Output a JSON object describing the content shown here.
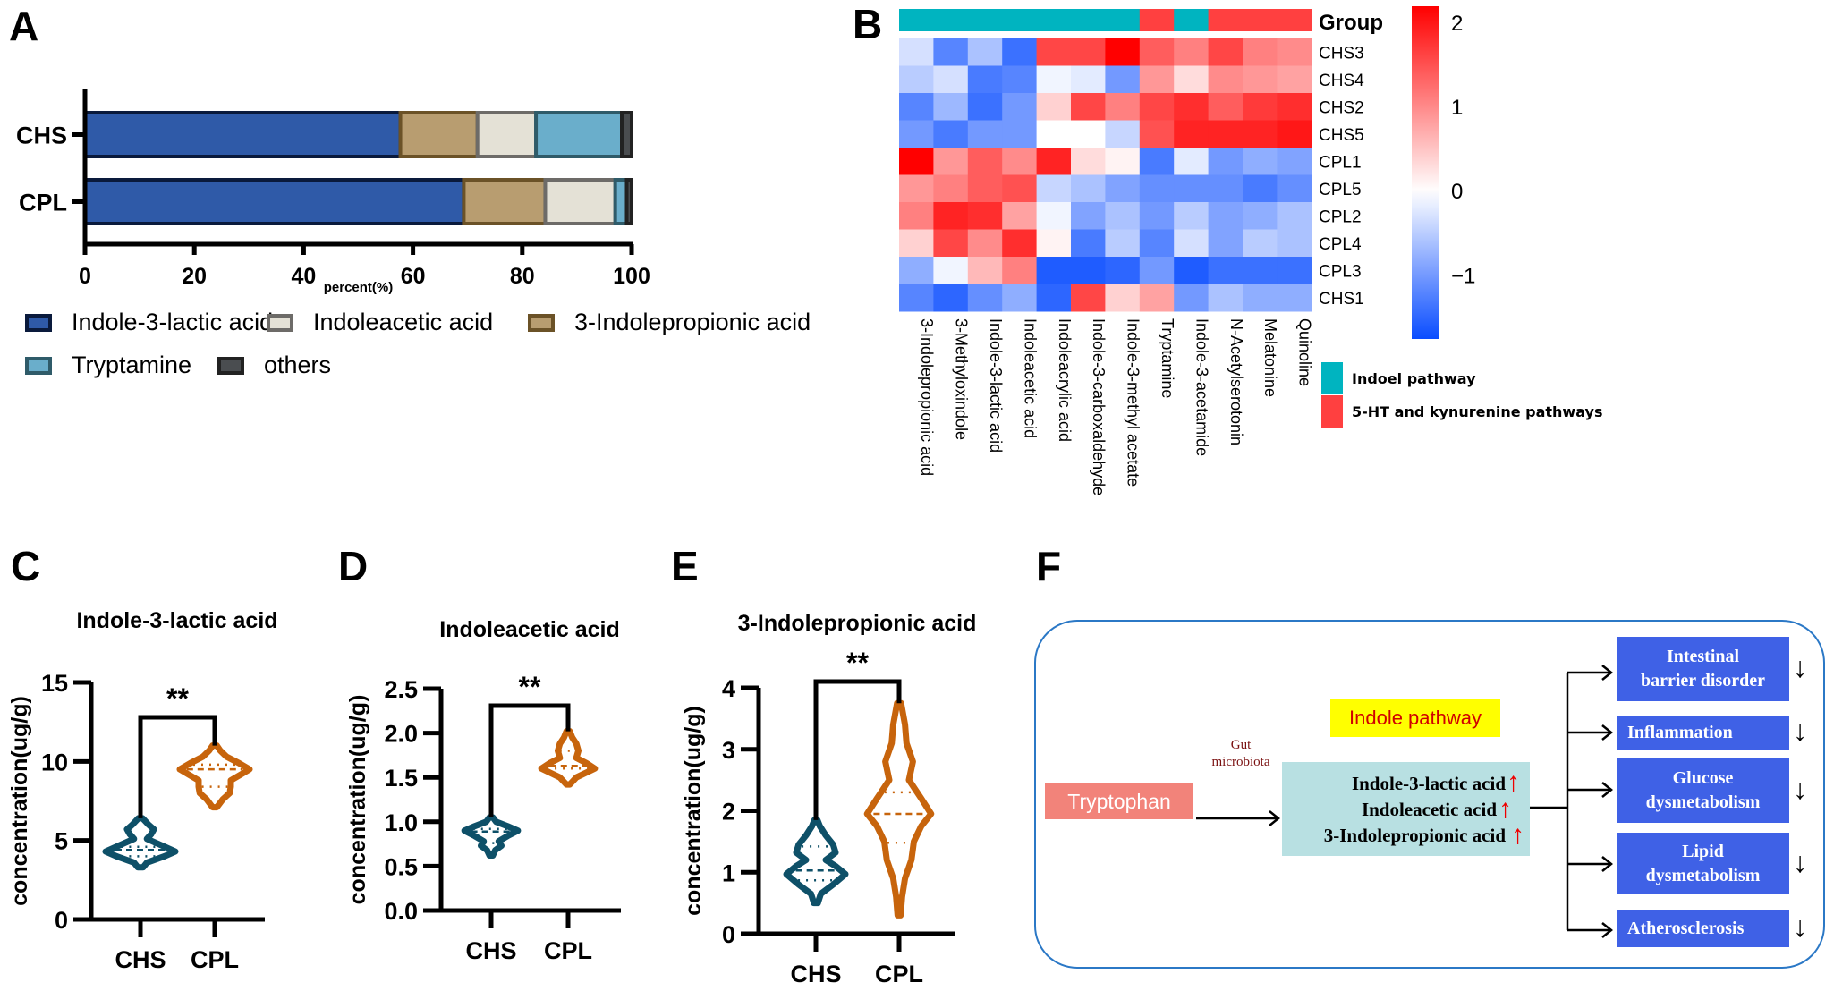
{
  "panels": {
    "A": "A",
    "B": "B",
    "C": "C",
    "D": "D",
    "E": "E",
    "F": "F"
  },
  "colors": {
    "ila": "#2f5aa8",
    "iaa": "#e4e1d6",
    "ipa": "#b89d70",
    "tryptamine": "#6aaecb",
    "others": "#4a4d50",
    "chs": "#0e5068",
    "cpl": "#c7640c",
    "indole_group": "#00b4c0",
    "ht_group": "#ff4040",
    "flow_blue": "#3f61e6",
    "flow_teal": "#b8e0e2",
    "flow_salmon": "#f2837a",
    "flow_yellow": "#ffff00",
    "flow_border": "#2b78c6"
  },
  "chart_data": [
    {
      "id": "A",
      "type": "bar",
      "orientation": "horizontal",
      "stacked": true,
      "categories": [
        "CHS",
        "CPL"
      ],
      "series": [
        {
          "name": "Indole-3-lactic acid",
          "key": "ila",
          "values": [
            57.7,
            69.3
          ]
        },
        {
          "name": "3-Indolepropionic acid",
          "key": "ipa",
          "values": [
            14.1,
            14.9
          ]
        },
        {
          "name": "Indoleacetic acid",
          "key": "iaa",
          "values": [
            10.7,
            12.8
          ]
        },
        {
          "name": "Tryptamine",
          "key": "tryptamine",
          "values": [
            15.7,
            2.1
          ]
        },
        {
          "name": "others",
          "key": "others",
          "values": [
            1.8,
            0.9
          ]
        }
      ],
      "legend": [
        {
          "name": "Indole-3-lactic acid",
          "key": "ila"
        },
        {
          "name": "Indoleacetic acid",
          "key": "iaa"
        },
        {
          "name": "3-Indolepropionic acid",
          "key": "ipa"
        },
        {
          "name": "Tryptamine",
          "key": "tryptamine"
        },
        {
          "name": "others",
          "key": "others"
        }
      ],
      "xlabel": "percent(%)",
      "xlim": [
        0,
        100
      ],
      "xticks": [
        "0",
        "20",
        "40",
        "60",
        "80",
        "100"
      ],
      "legend_position": "bottom"
    },
    {
      "id": "B",
      "type": "heatmap",
      "rows": [
        "CHS3",
        "CHS4",
        "CHS2",
        "CHS5",
        "CPL1",
        "CPL5",
        "CPL2",
        "CPL4",
        "CPL3",
        "CHS1"
      ],
      "columns": [
        "3-Indolepropionic acid",
        "3-Methyloxindole",
        "Indole-3-lactic acid",
        "Indoleacetic acid",
        "Indoleacrylic acid",
        "Indole-3-carboxaldehyde",
        "Indole-3-methyl acetate",
        "Tryptamine",
        "Indole-3-acetamide",
        "N-Acetylserotonin",
        "Melatonine",
        "Quinoline"
      ],
      "column_groups": [
        "indole",
        "indole",
        "indole",
        "indole",
        "indole",
        "indole",
        "indole",
        "ht",
        "indole",
        "ht",
        "ht",
        "ht"
      ],
      "values": [
        [
          -0.3,
          -1.2,
          -0.6,
          -1.4,
          1.6,
          1.6,
          2.2,
          1.4,
          1.1,
          1.6,
          1.1,
          1.0
        ],
        [
          -0.5,
          -0.3,
          -1.3,
          -1.2,
          -0.1,
          -0.2,
          -1.0,
          0.9,
          0.3,
          1.0,
          0.9,
          0.8
        ],
        [
          -1.2,
          -0.7,
          -1.4,
          -1.0,
          0.4,
          1.6,
          1.1,
          1.6,
          1.8,
          1.4,
          1.7,
          1.8
        ],
        [
          -1.0,
          -1.3,
          -1.0,
          -1.0,
          0.0,
          0.0,
          -0.4,
          1.5,
          1.9,
          1.9,
          1.9,
          2.0
        ],
        [
          2.2,
          0.9,
          1.4,
          1.0,
          1.9,
          0.3,
          0.1,
          -1.3,
          -0.2,
          -1.0,
          -0.8,
          -0.9
        ],
        [
          0.9,
          1.1,
          1.4,
          1.5,
          -0.4,
          -0.6,
          -0.9,
          -1.1,
          -1.1,
          -1.1,
          -1.3,
          -1.1
        ],
        [
          1.1,
          1.9,
          1.8,
          0.8,
          -0.1,
          -0.9,
          -0.6,
          -1.0,
          -0.5,
          -0.9,
          -0.8,
          -0.6
        ],
        [
          0.4,
          1.6,
          1.0,
          1.8,
          0.1,
          -1.3,
          -0.5,
          -1.2,
          -0.3,
          -0.9,
          -0.5,
          -0.6
        ],
        [
          -0.8,
          -0.1,
          0.6,
          1.1,
          -1.6,
          -1.6,
          -1.5,
          -1.0,
          -1.6,
          -1.4,
          -1.4,
          -1.4
        ],
        [
          -1.2,
          -1.5,
          -1.1,
          -0.8,
          -1.5,
          1.6,
          0.4,
          0.8,
          -1.0,
          -0.6,
          -0.8,
          -0.8
        ]
      ],
      "group_label": "Group",
      "colorbar": {
        "min": -1.75,
        "max": 2.2,
        "ticks": [
          2,
          1,
          0,
          -1
        ],
        "tick_labels": [
          "2",
          "1",
          "0",
          "−1"
        ]
      },
      "group_legend": [
        {
          "key": "indole",
          "label": "Indoel pathway"
        },
        {
          "key": "ht",
          "label": "5-HT and kynurenine pathways"
        }
      ]
    },
    {
      "id": "C",
      "type": "violin",
      "title": "Indole-3-lactic acid",
      "ylabel": "concentration(ug/g)",
      "ylim": [
        0,
        15
      ],
      "yticks": [
        "0",
        "5",
        "10",
        "15"
      ],
      "categories": [
        "CHS",
        "CPL"
      ],
      "groups": [
        {
          "name": "CHS",
          "min": 3.3,
          "max": 6.4,
          "median": 4.4,
          "q1": 4.0,
          "q3": 4.6,
          "profile": [
            [
              3.3,
              0.05
            ],
            [
              3.6,
              0.12
            ],
            [
              4.0,
              0.45
            ],
            [
              4.3,
              0.65
            ],
            [
              4.6,
              0.45
            ],
            [
              5.1,
              0.12
            ],
            [
              5.4,
              0.2
            ],
            [
              5.7,
              0.25
            ],
            [
              6.0,
              0.15
            ],
            [
              6.4,
              0.04
            ]
          ]
        },
        {
          "name": "CPL",
          "min": 7.1,
          "max": 11.0,
          "median": 9.5,
          "q1": 8.4,
          "q3": 9.8,
          "profile": [
            [
              7.1,
              0.04
            ],
            [
              7.6,
              0.15
            ],
            [
              8.0,
              0.28
            ],
            [
              8.4,
              0.3
            ],
            [
              8.8,
              0.3
            ],
            [
              9.2,
              0.5
            ],
            [
              9.5,
              0.65
            ],
            [
              9.9,
              0.45
            ],
            [
              10.3,
              0.22
            ],
            [
              10.7,
              0.1
            ],
            [
              11.0,
              0.04
            ]
          ]
        }
      ],
      "significance": "**"
    },
    {
      "id": "D",
      "type": "violin",
      "title": "Indoleacetic acid",
      "ylabel": "concentration(ug/g)",
      "ylim": [
        0,
        2.5
      ],
      "yticks": [
        "0.0",
        "0.5",
        "1.0",
        "1.5",
        "2.0",
        "2.5"
      ],
      "categories": [
        "CHS",
        "CPL"
      ],
      "groups": [
        {
          "name": "CHS",
          "min": 0.62,
          "max": 1.05,
          "median": 0.89,
          "q1": 0.76,
          "q3": 0.92,
          "profile": [
            [
              0.62,
              0.04
            ],
            [
              0.68,
              0.1
            ],
            [
              0.73,
              0.25
            ],
            [
              0.78,
              0.18
            ],
            [
              0.84,
              0.4
            ],
            [
              0.9,
              0.65
            ],
            [
              0.95,
              0.4
            ],
            [
              1.0,
              0.12
            ],
            [
              1.05,
              0.04
            ]
          ]
        },
        {
          "name": "CPL",
          "min": 1.42,
          "max": 2.02,
          "median": 1.63,
          "q1": 1.6,
          "q3": 1.8,
          "profile": [
            [
              1.42,
              0.04
            ],
            [
              1.5,
              0.2
            ],
            [
              1.6,
              0.65
            ],
            [
              1.66,
              0.45
            ],
            [
              1.72,
              0.2
            ],
            [
              1.8,
              0.25
            ],
            [
              1.88,
              0.2
            ],
            [
              1.95,
              0.1
            ],
            [
              2.02,
              0.04
            ]
          ]
        }
      ],
      "significance": "**"
    },
    {
      "id": "E",
      "type": "violin",
      "title": "3-Indolepropionic acid",
      "ylabel": "concentration(ug/g)",
      "ylim": [
        0,
        4
      ],
      "yticks": [
        "0",
        "1",
        "2",
        "3",
        "4"
      ],
      "categories": [
        "CHS",
        "CPL"
      ],
      "groups": [
        {
          "name": "CHS",
          "min": 0.5,
          "max": 1.85,
          "median": 1.03,
          "q1": 0.87,
          "q3": 1.42,
          "profile": [
            [
              0.5,
              0.04
            ],
            [
              0.65,
              0.1
            ],
            [
              0.8,
              0.35
            ],
            [
              0.97,
              0.6
            ],
            [
              1.1,
              0.4
            ],
            [
              1.2,
              0.2
            ],
            [
              1.32,
              0.4
            ],
            [
              1.45,
              0.35
            ],
            [
              1.6,
              0.2
            ],
            [
              1.75,
              0.08
            ],
            [
              1.85,
              0.03
            ]
          ]
        },
        {
          "name": "CPL",
          "min": 0.3,
          "max": 3.75,
          "median": 1.95,
          "q1": 1.48,
          "q3": 2.3,
          "profile": [
            [
              0.3,
              0.03
            ],
            [
              0.6,
              0.06
            ],
            [
              0.9,
              0.12
            ],
            [
              1.2,
              0.25
            ],
            [
              1.5,
              0.3
            ],
            [
              1.75,
              0.45
            ],
            [
              1.95,
              0.65
            ],
            [
              2.2,
              0.45
            ],
            [
              2.5,
              0.2
            ],
            [
              2.8,
              0.28
            ],
            [
              3.1,
              0.15
            ],
            [
              3.4,
              0.12
            ],
            [
              3.75,
              0.04
            ]
          ]
        }
      ],
      "significance": "**"
    }
  ],
  "diagram": {
    "tryptophan": "Tryptophan",
    "gut_label_1": "Gut",
    "gut_label_2": "microbiota",
    "pathway_title": "Indole pathway",
    "metabolites": [
      "Indole-3-lactic acid",
      "Indoleacetic acid",
      "3-Indolepropionic acid"
    ],
    "up_arrow": "↑",
    "down_arrow": "↓",
    "outcomes": [
      {
        "line1": "Intestinal",
        "line2": "barrier disorder"
      },
      {
        "line1": "Inflammation",
        "line2": ""
      },
      {
        "line1": "Glucose",
        "line2": "dysmetabolism"
      },
      {
        "line1": "Lipid",
        "line2": "dysmetabolism"
      },
      {
        "line1": "Atherosclerosis",
        "line2": ""
      }
    ]
  }
}
